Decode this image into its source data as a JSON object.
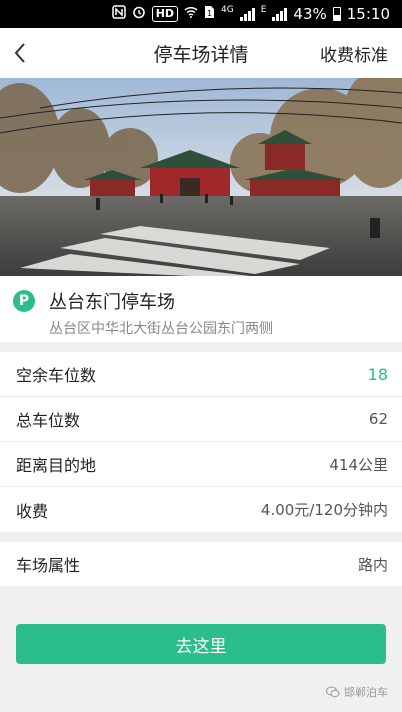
{
  "status_bar": {
    "network": "4G",
    "network_sup": "E",
    "hd": "HD",
    "battery": "43%",
    "time": "15:10",
    "icons": [
      "nfc-icon",
      "alarm-icon",
      "hd-icon",
      "wifi-icon",
      "sim-icon",
      "signal-icon",
      "battery-icon"
    ]
  },
  "navbar": {
    "back_icon": "chevron-left-icon",
    "title": "停车场详情",
    "right_action": "收费标准"
  },
  "parking_lot": {
    "badge": "P",
    "name": "丛台东门停车场",
    "address": "丛台区中华北大街丛台公园东门两侧"
  },
  "details": [
    {
      "label": "空余车位数",
      "value": "18",
      "accent": true
    },
    {
      "label": "总车位数",
      "value": "62",
      "accent": false
    },
    {
      "label": "距离目的地",
      "value": "414公里",
      "accent": false
    },
    {
      "label": "收费",
      "value": "4.00元/120分钟内",
      "accent": false
    }
  ],
  "attribute": {
    "label": "车场属性",
    "value": "路内"
  },
  "action": {
    "go_label": "去这里"
  },
  "watermark": {
    "text": "邯郸泊车"
  },
  "colors": {
    "accent": "#2bbd8a",
    "background": "#f0f0f0"
  }
}
